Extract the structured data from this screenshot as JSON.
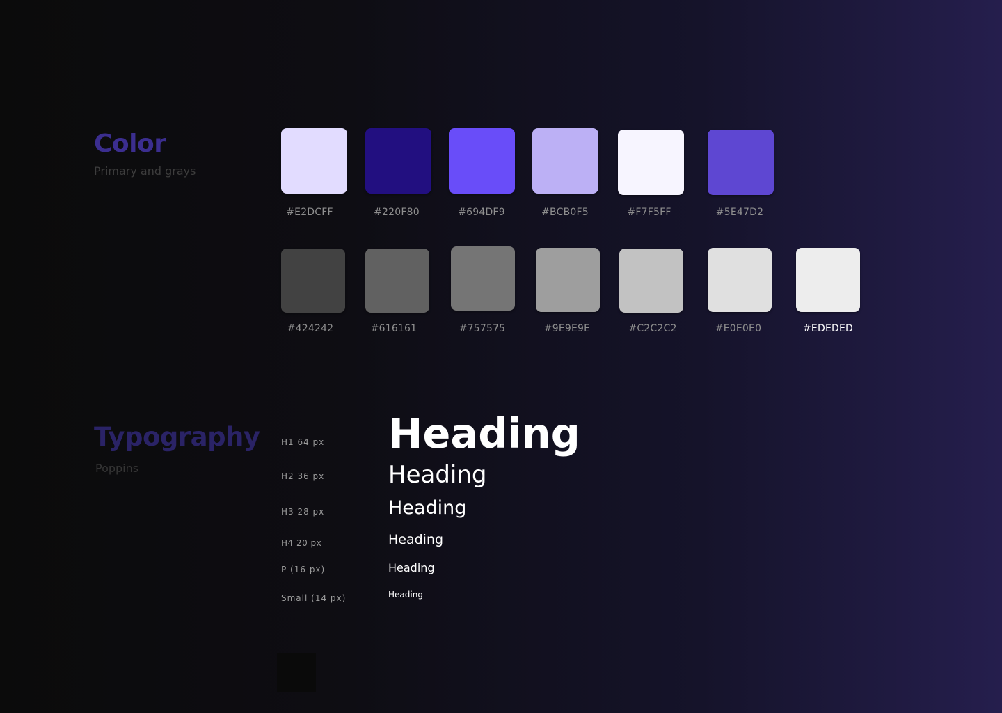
{
  "color_section": {
    "title": "Color",
    "subtitle": "Primary and grays",
    "title_color": "#3b2e8f"
  },
  "primary_swatches": [
    {
      "hex": "#E2DCFF",
      "color": "#E2DCFF"
    },
    {
      "hex": "#220F80",
      "color": "#220F80"
    },
    {
      "hex": "#694DF9",
      "color": "#694DF9"
    },
    {
      "hex": "#BCB0F5",
      "color": "#BCB0F5"
    },
    {
      "hex": "#F7F5FF",
      "color": "#F7F5FF"
    },
    {
      "hex": "#5E47D2",
      "color": "#5E47D2"
    }
  ],
  "gray_swatches": [
    {
      "hex": "#424242",
      "color": "#424242"
    },
    {
      "hex": "#616161",
      "color": "#616161"
    },
    {
      "hex": "#757575",
      "color": "#757575"
    },
    {
      "hex": "#9E9E9E",
      "color": "#9E9E9E"
    },
    {
      "hex": "#C2C2C2",
      "color": "#C2C2C2"
    },
    {
      "hex": "#E0E0E0",
      "color": "#E0E0E0"
    },
    {
      "hex": "#EDEDED",
      "color": "#EDEDED"
    }
  ],
  "typography_section": {
    "title": "Typography",
    "subtitle": "Poppins",
    "title_color": "#2a2366"
  },
  "type_scale": [
    {
      "label": "H1 64 px",
      "sample": "Heading"
    },
    {
      "label": "H2 36 px",
      "sample": "Heading"
    },
    {
      "label": "H3 28 px",
      "sample": "Heading"
    },
    {
      "label": "H4 20 px",
      "sample": "Heading"
    },
    {
      "label": "P (16 px)",
      "sample": "Heading"
    },
    {
      "label": "Small (14 px)",
      "sample": "Heading"
    }
  ]
}
